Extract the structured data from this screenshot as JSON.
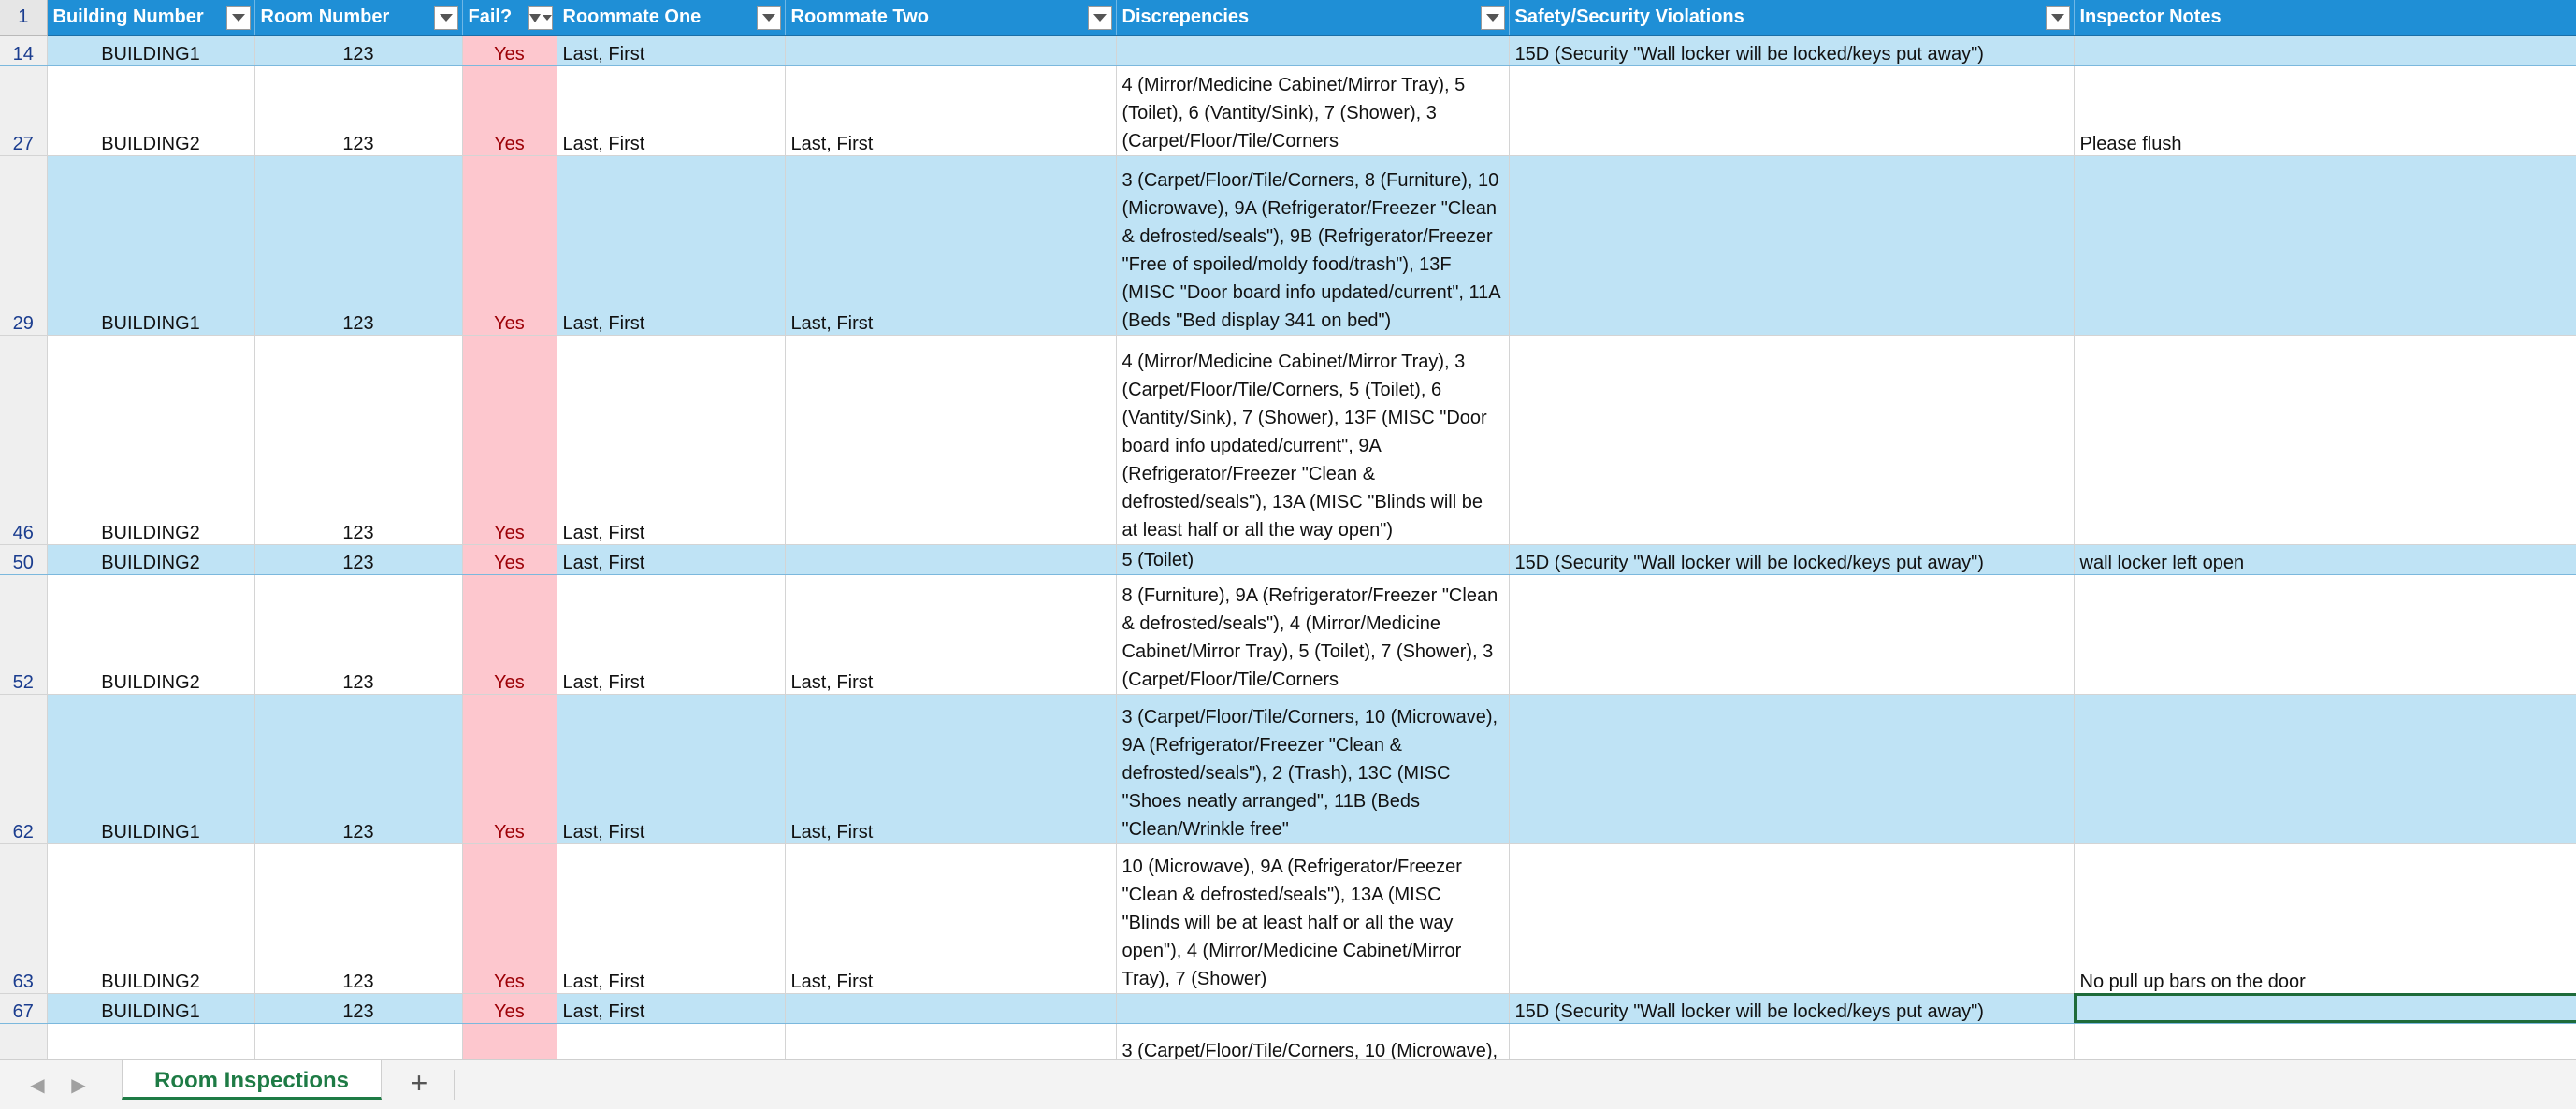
{
  "columns": [
    "Building Number",
    "Room Number",
    "Fail?",
    "Roommate One",
    "Roommate Two",
    "Discrepencies",
    "Safety/Security Violations",
    "Inspector Notes"
  ],
  "header_row_number": "1",
  "rows": [
    {
      "n": "14",
      "building": "BUILDING1",
      "room": "123",
      "fail": "Yes",
      "rm1": "Last, First",
      "rm2": "",
      "disc": "",
      "safety": "15D (Security \"Wall locker will be locked/keys put away\")",
      "notes": ""
    },
    {
      "n": "27",
      "building": "BUILDING2",
      "room": "123",
      "fail": "Yes",
      "rm1": "Last, First",
      "rm2": "Last, First",
      "disc": "4 (Mirror/Medicine Cabinet/Mirror Tray), 5 (Toilet), 6 (Vantity/Sink), 7 (Shower), 3 (Carpet/Floor/Tile/Corners",
      "safety": "",
      "notes": "Please flush"
    },
    {
      "n": "29",
      "building": "BUILDING1",
      "room": "123",
      "fail": "Yes",
      "rm1": "Last, First",
      "rm2": "Last, First",
      "disc": "3 (Carpet/Floor/Tile/Corners, 8 (Furniture), 10 (Microwave), 9A (Refrigerator/Freezer \"Clean & defrosted/seals\"), 9B (Refrigerator/Freezer \"Free of spoiled/moldy food/trash\"), 13F (MISC \"Door board info updated/current\", 11A (Beds \"Bed display 341 on bed\")",
      "safety": "",
      "notes": ""
    },
    {
      "n": "46",
      "building": "BUILDING2",
      "room": "123",
      "fail": "Yes",
      "rm1": "Last, First",
      "rm2": "",
      "disc": "4 (Mirror/Medicine Cabinet/Mirror Tray), 3 (Carpet/Floor/Tile/Corners, 5 (Toilet), 6 (Vantity/Sink), 7 (Shower), 13F (MISC \"Door board info updated/current\", 9A (Refrigerator/Freezer \"Clean & defrosted/seals\"), 13A (MISC \"Blinds will be at least half or all the way open\")",
      "safety": "",
      "notes": ""
    },
    {
      "n": "50",
      "building": "BUILDING2",
      "room": "123",
      "fail": "Yes",
      "rm1": "Last, First",
      "rm2": "",
      "disc": "5 (Toilet)",
      "safety": "15D (Security \"Wall locker will be locked/keys put away\")",
      "notes": "wall locker left open"
    },
    {
      "n": "52",
      "building": "BUILDING2",
      "room": "123",
      "fail": "Yes",
      "rm1": "Last, First",
      "rm2": "Last, First",
      "disc": "8 (Furniture), 9A (Refrigerator/Freezer \"Clean & defrosted/seals\"), 4 (Mirror/Medicine Cabinet/Mirror Tray), 5 (Toilet), 7 (Shower), 3 (Carpet/Floor/Tile/Corners",
      "safety": "",
      "notes": ""
    },
    {
      "n": "62",
      "building": "BUILDING1",
      "room": "123",
      "fail": "Yes",
      "rm1": "Last, First",
      "rm2": "Last, First",
      "disc": "3 (Carpet/Floor/Tile/Corners, 10 (Microwave), 9A (Refrigerator/Freezer \"Clean & defrosted/seals\"), 2 (Trash), 13C (MISC \"Shoes neatly arranged\", 11B (Beds \"Clean/Wrinkle free\"",
      "safety": "",
      "notes": ""
    },
    {
      "n": "63",
      "building": "BUILDING2",
      "room": "123",
      "fail": "Yes",
      "rm1": "Last, First",
      "rm2": "Last, First",
      "disc": "10 (Microwave), 9A (Refrigerator/Freezer \"Clean & defrosted/seals\"), 13A (MISC \"Blinds will be at least half or all the way open\"), 4 (Mirror/Medicine Cabinet/Mirror Tray), 7 (Shower)",
      "safety": "",
      "notes": "No pull up bars on the door"
    },
    {
      "n": "67",
      "building": "BUILDING1",
      "room": "123",
      "fail": "Yes",
      "rm1": "Last, First",
      "rm2": "",
      "disc": "",
      "safety": "15D (Security \"Wall locker will be locked/keys put away\")",
      "notes": ""
    },
    {
      "n": "",
      "building": "",
      "room": "",
      "fail": "",
      "rm1": "",
      "rm2": "",
      "disc": "3 (Carpet/Floor/Tile/Corners, 10 (Microwave),",
      "safety": "",
      "notes": ""
    }
  ],
  "sheet_tab": "Room Inspections",
  "add_sheet_label": "+",
  "nav": {
    "prev": "◀",
    "next": "▶"
  }
}
